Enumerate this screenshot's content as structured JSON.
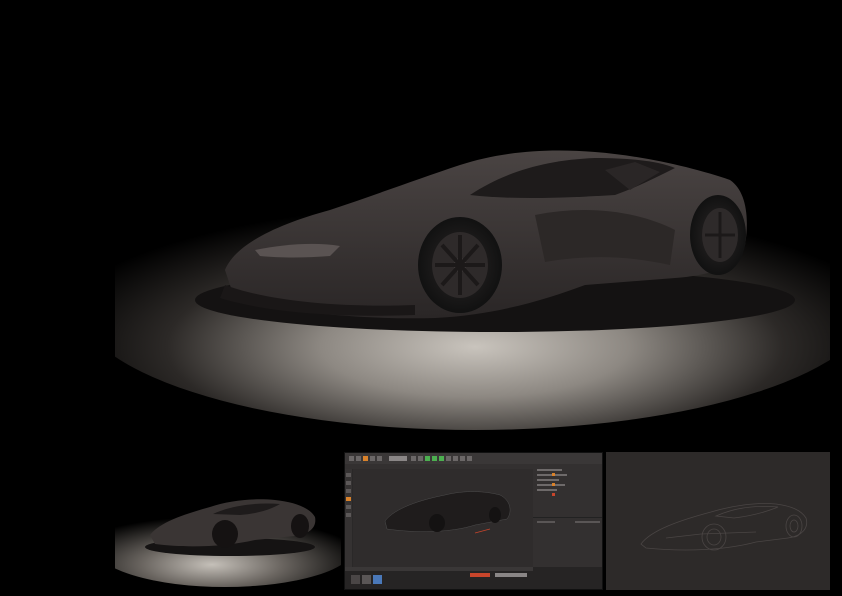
{
  "panels": [
    {
      "id": "hero",
      "content": "car-render-large"
    },
    {
      "id": "thumb1",
      "content": "car-render-small"
    },
    {
      "id": "thumb2",
      "content": "3d-editor-viewport"
    },
    {
      "id": "thumb3",
      "content": "car-line-sketch"
    }
  ],
  "colors": {
    "background": "#000000",
    "floor_light": "#b9b4ae",
    "car_body": "#3a3534",
    "car_dark": "#1f1c1c",
    "editor_bg": "#2a2828",
    "editor_accent_green": "#4caf50",
    "editor_accent_orange": "#d9822b",
    "sketch_bg": "#2d2a29"
  },
  "icons": [
    "wheel-icon"
  ]
}
